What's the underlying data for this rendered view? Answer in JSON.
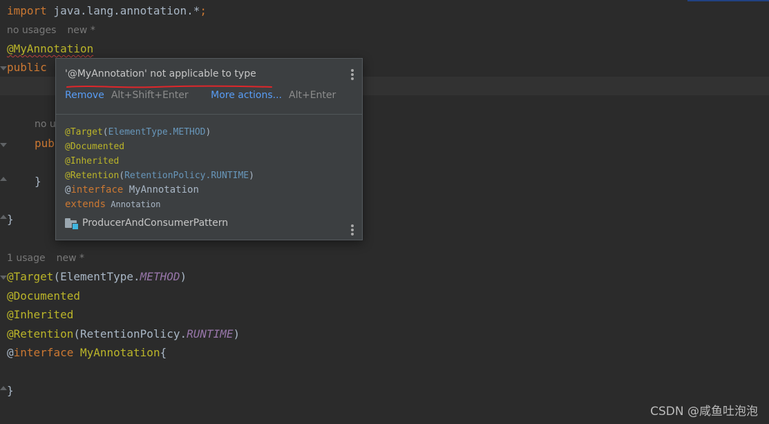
{
  "editor": {
    "line_import": {
      "keyword": "import",
      "path": " java.lang.annotation.*",
      "semicolon": ";"
    },
    "hint1": {
      "usages": "no usages",
      "status": "new *"
    },
    "line_annotation": "@MyAnnotation",
    "line_public": "public",
    "hint2": {
      "usages": "no u"
    },
    "line_pub": "pub",
    "brace_close_inner": "}",
    "brace_close_outer": "}",
    "hint3": {
      "usages": "1 usage",
      "status": "new *"
    },
    "target": {
      "ann": "@Target",
      "open": "(ElementType.",
      "const": "METHOD",
      "close": ")"
    },
    "documented": "@Documented",
    "inherited": "@Inherited",
    "retention": {
      "ann": "@Retention",
      "open": "(RetentionPolicy.",
      "const": "RUNTIME",
      "close": ")"
    },
    "iface": {
      "at": "@",
      "keyword": "interface",
      "name": " MyAnnotation",
      "brace": "{"
    },
    "brace_final": "}"
  },
  "popup": {
    "title": "'@MyAnnotation' not applicable to type",
    "actions": {
      "remove_label": "Remove",
      "remove_shortcut": "Alt+Shift+Enter",
      "more_label": "More actions...",
      "more_shortcut": "Alt+Enter"
    },
    "doc": {
      "target": {
        "ann": "@Target",
        "open": "(",
        "const": "ElementType.METHOD",
        "close": ")"
      },
      "documented": "@Documented",
      "inherited": "@Inherited",
      "retention": {
        "ann": "@Retention",
        "open": "(",
        "const": "RetentionPolicy.RUNTIME",
        "close": ")"
      },
      "iface": {
        "at": "@",
        "keyword": "interface",
        "name": " MyAnnotation"
      },
      "extends": {
        "keyword": "extends",
        "name": " Annotation"
      }
    },
    "location": "ProducerAndConsumerPattern"
  },
  "watermark": "CSDN @咸鱼吐泡泡",
  "colors": {
    "background": "#2b2b2b",
    "keyword": "#cc7832",
    "annotation": "#bbb529",
    "constant": "#9876aa",
    "link": "#589df6",
    "error_mark": "#e0262a"
  }
}
